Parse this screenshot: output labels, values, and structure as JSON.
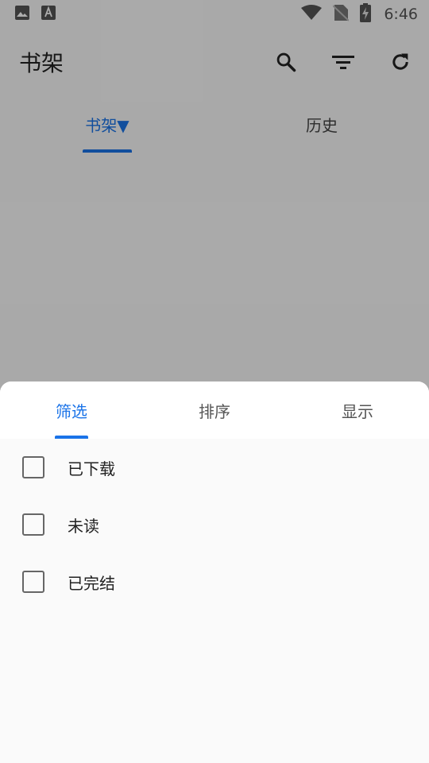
{
  "status_bar": {
    "time": "6:46",
    "icons": [
      "image-icon",
      "font-icon",
      "wifi-icon",
      "no-sim-icon",
      "battery-charging-icon"
    ]
  },
  "app_bar": {
    "title": "书架",
    "actions": [
      "search-icon",
      "filter-icon",
      "refresh-icon"
    ]
  },
  "main_tabs": [
    {
      "label": "书架▼",
      "active": true
    },
    {
      "label": "历史",
      "active": false
    }
  ],
  "sheet": {
    "tabs": [
      {
        "label": "筛选",
        "active": true
      },
      {
        "label": "排序",
        "active": false
      },
      {
        "label": "显示",
        "active": false
      }
    ],
    "filters": [
      {
        "label": "已下载",
        "checked": false
      },
      {
        "label": "未读",
        "checked": false
      },
      {
        "label": "已完结",
        "checked": false
      }
    ]
  },
  "colors": {
    "accent": "#1a73e8",
    "scrim": "rgba(0,0,0,0.32)"
  }
}
